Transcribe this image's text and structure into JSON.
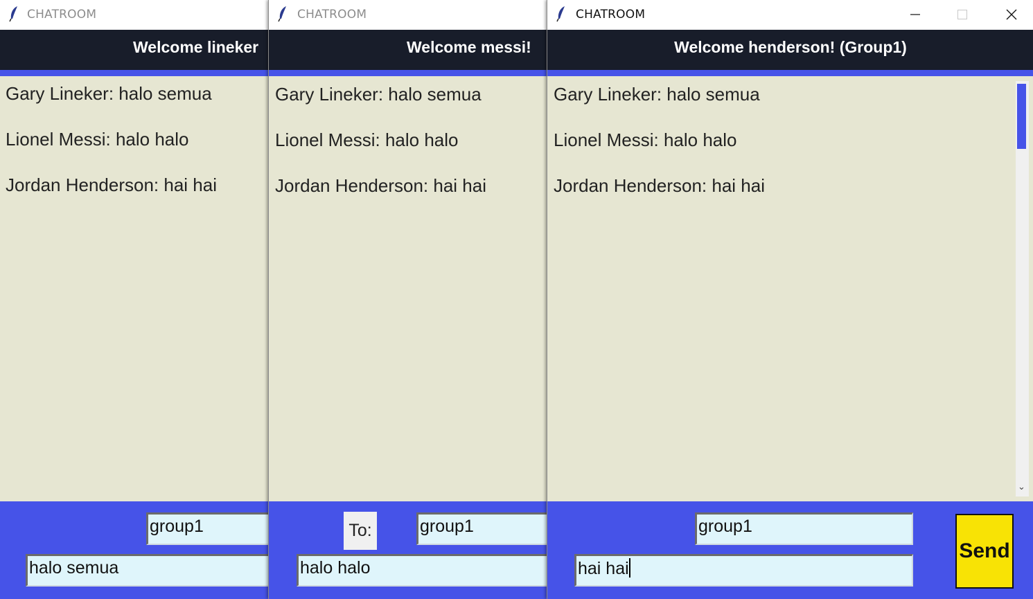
{
  "windows": [
    {
      "title": "CHATROOM",
      "header": "Welcome lineker",
      "messages": [
        "Gary Lineker: halo semua",
        "Lionel Messi: halo halo",
        "Jordan Henderson: hai hai"
      ],
      "recipient_value": "group1",
      "message_value": "halo semua"
    },
    {
      "title": "CHATROOM",
      "header": "Welcome messi!",
      "messages": [
        "Gary Lineker: halo semua",
        "Lionel Messi: halo halo",
        "Jordan Henderson: hai hai"
      ],
      "to_label": "To:",
      "recipient_value": "group1",
      "message_value": "halo halo"
    },
    {
      "title": "CHATROOM",
      "header": "Welcome henderson! (Group1)",
      "messages": [
        "Gary Lineker: halo semua",
        "Lionel Messi: halo halo",
        "Jordan Henderson: hai hai"
      ],
      "recipient_value": "group1",
      "message_value": "hai hai",
      "send_label": "Send"
    }
  ],
  "icons": {
    "app": "feather-icon",
    "minimize": "minimize-icon",
    "maximize": "maximize-icon",
    "close": "close-icon"
  },
  "colors": {
    "header_bg": "#181d2a",
    "accent": "#4653e8",
    "chat_bg": "#e6e6d2",
    "input_bg": "#dff5fb",
    "send_bg": "#f8e305"
  }
}
